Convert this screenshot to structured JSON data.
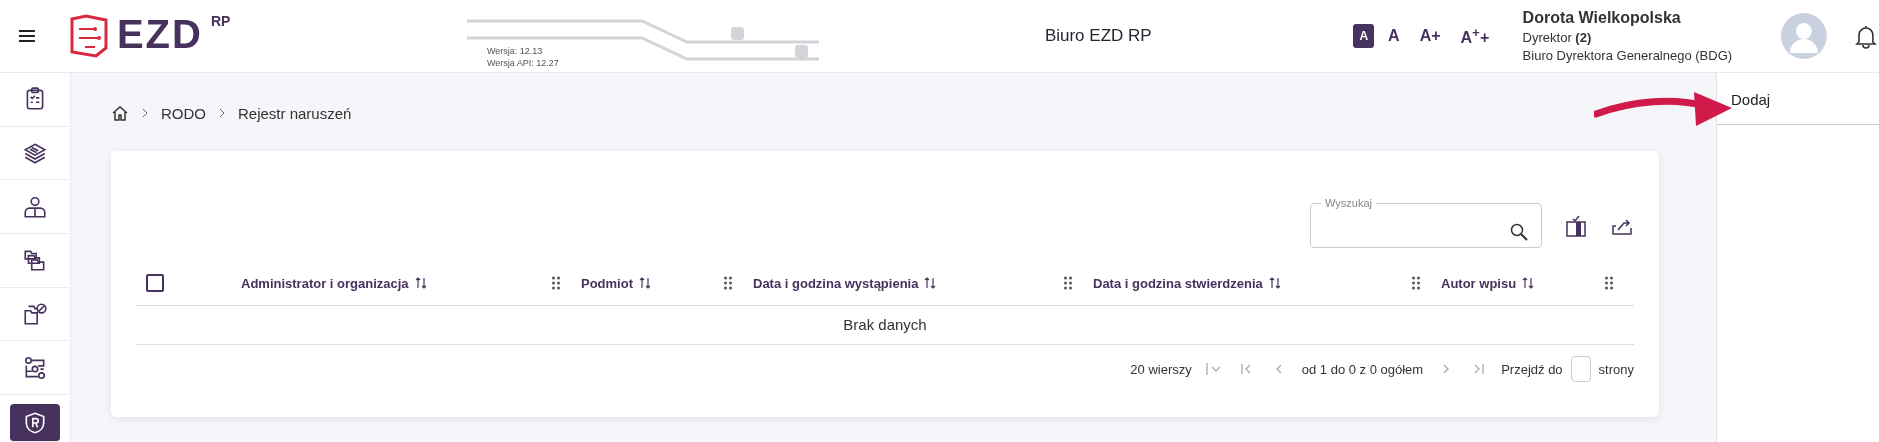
{
  "header": {
    "logo": {
      "text": "EZD",
      "superscript": "RP"
    },
    "versions": [
      "Wersja: 12.13",
      "Wersja API: 12.27"
    ],
    "title": "Biuro EZD RP",
    "font_sizes": [
      {
        "label": "A",
        "selected": true
      },
      {
        "label": "A",
        "selected": false
      },
      {
        "label": "A+",
        "selected": false
      },
      {
        "label": "A$^{+}$+",
        "selected": false
      }
    ],
    "user": {
      "name": "Dorota Wielkopolska",
      "role": "Dyrektor **(2)**",
      "unit": "Biuro Dyrektora Generalnego (BDG)"
    }
  },
  "sidebar": {
    "items": [
      {
        "kind": "tasks",
        "selected": false
      },
      {
        "kind": "layers",
        "selected": false
      },
      {
        "kind": "person",
        "selected": false
      },
      {
        "kind": "folders",
        "selected": false
      },
      {
        "kind": "blocked",
        "selected": false
      },
      {
        "kind": "workflow",
        "selected": false
      },
      {
        "kind": "rodo",
        "selected": true
      }
    ]
  },
  "breadcrumb": [
    "RODO",
    "Rejestr naruszeń"
  ],
  "table": {
    "search": {
      "label": "Wyszukaj"
    },
    "select_all": {
      "checked": false
    },
    "columns": [
      "Administrator i organizacja",
      "Podmiot",
      "Data i godzina wystąpienia",
      "Data i godzina stwierdzenia",
      "Autor wpisu"
    ],
    "empty_message": "Brak danych",
    "pagination": {
      "rows_per_page": "20 wierszy",
      "range": "od 1 do 0 z 0 ogółem",
      "goto_label": "Przejdź do",
      "goto_suffix": "strony"
    }
  },
  "side_panel": {
    "action": "Dodaj"
  }
}
